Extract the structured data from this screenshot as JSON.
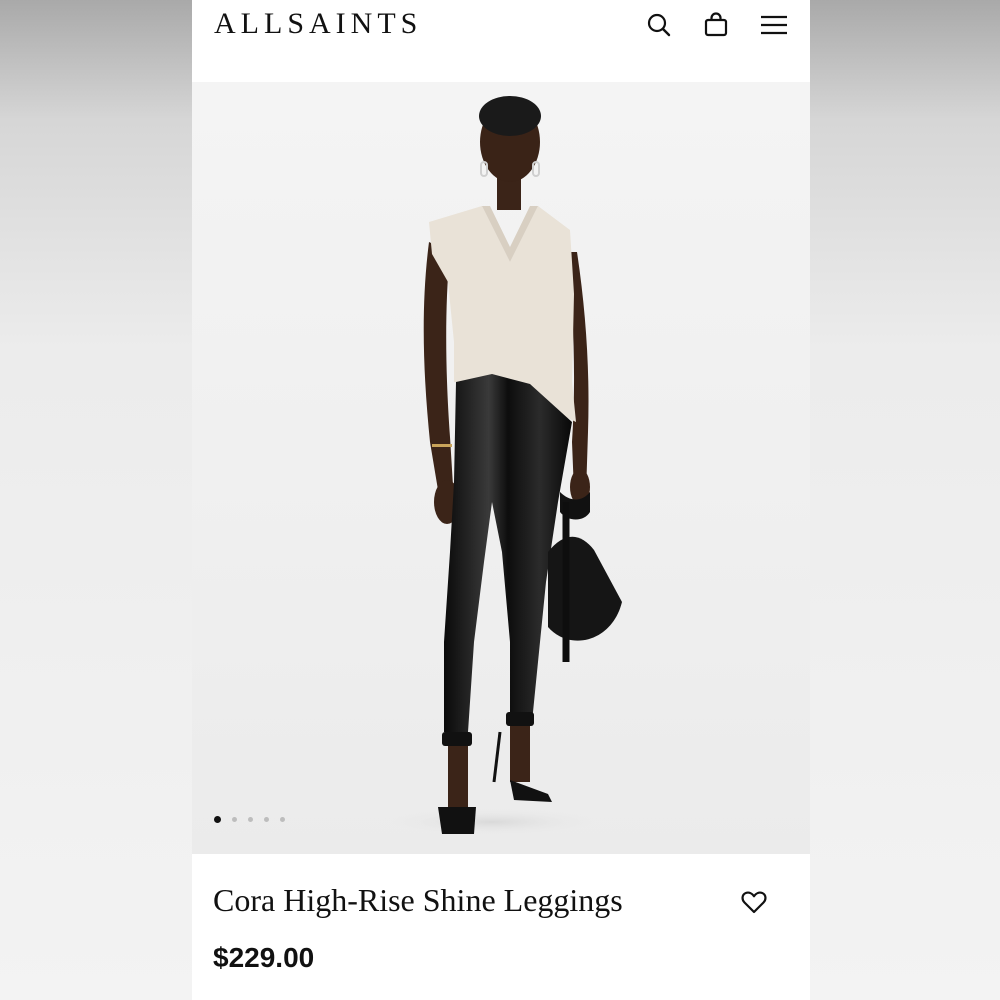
{
  "header": {
    "brand": "ALLSAINTS",
    "icons": [
      "search-icon",
      "bag-icon",
      "menu-icon"
    ]
  },
  "gallery": {
    "image_count": 5,
    "active_index": 1
  },
  "product": {
    "name": "Cora High-Rise Shine Leggings",
    "price": "$229.00"
  },
  "colors": {
    "text": "#111111",
    "background": "#ffffff",
    "image_bg": "#efefef",
    "dot_inactive": "#bdbdbd"
  }
}
